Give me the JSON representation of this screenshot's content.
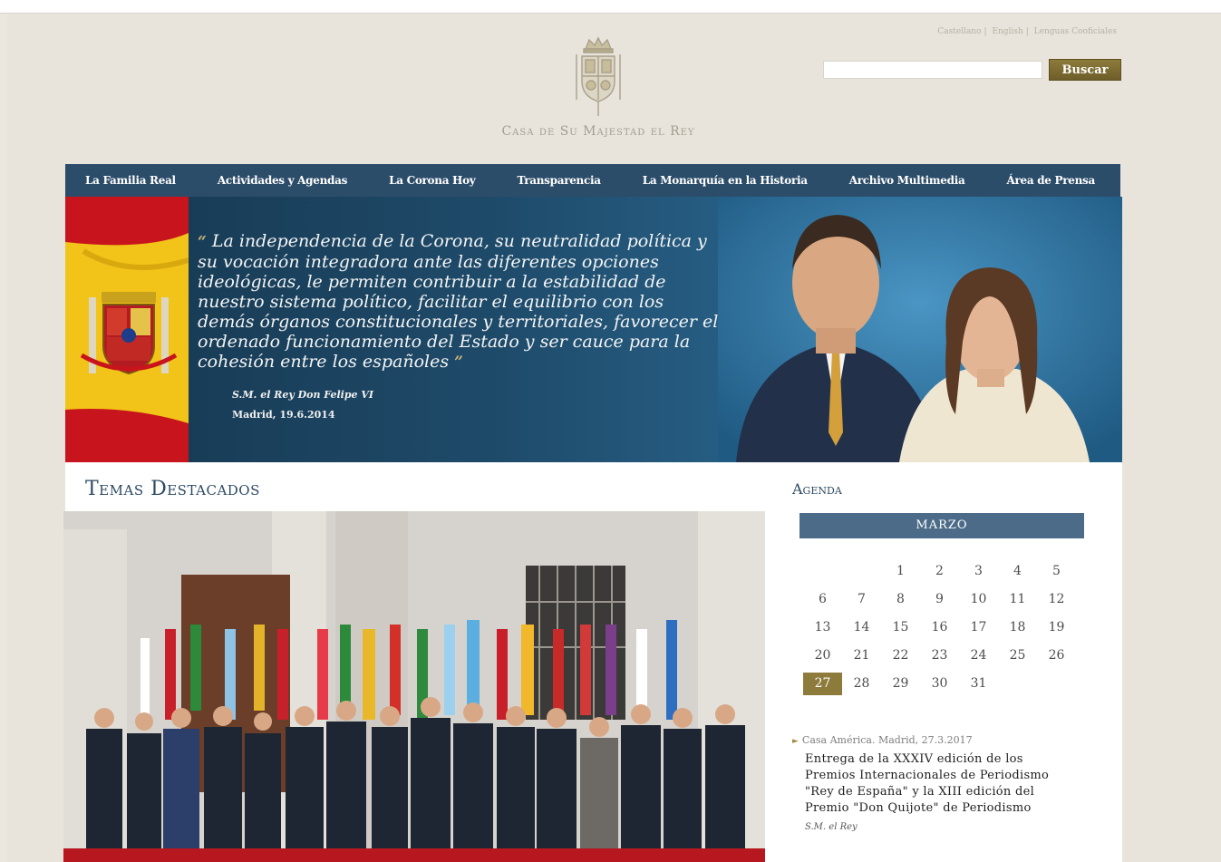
{
  "header": {
    "site_title": "Casa de Su Majestad el Rey",
    "lang_links": [
      "Castellano",
      "English",
      "Lenguas Cooficiales"
    ],
    "search_placeholder": "",
    "search_button": "Buscar"
  },
  "nav": {
    "items": [
      "La Familia Real",
      "Actividades y Agendas",
      "La Corona Hoy",
      "Transparencia",
      "La Monarquía en la Historia",
      "Archivo Multimedia",
      "Área de Prensa"
    ]
  },
  "hero": {
    "quote": "La independencia de la Corona, su neutralidad política y su vocación integradora ante las diferentes opciones ideológicas, le permiten contribuir a la estabilidad de nuestro sistema político, facilitar el equilibrio con los demás órganos constitucionales y territoriales, favorecer el ordenado funcionamiento del Estado y ser cauce para la cohesión entre los españoles",
    "open_mark": "“",
    "close_mark": "”",
    "author": "S.M. el Rey Don Felipe VI",
    "place_date": "Madrid, 19.6.2014"
  },
  "featured": {
    "title": "Temas Destacados"
  },
  "agenda": {
    "title": "Agenda",
    "month": "MARZO",
    "weeks": [
      [
        "",
        "",
        "1",
        "2",
        "3",
        "4",
        "5"
      ],
      [
        "6",
        "7",
        "8",
        "9",
        "10",
        "11",
        "12"
      ],
      [
        "13",
        "14",
        "15",
        "16",
        "17",
        "18",
        "19"
      ],
      [
        "20",
        "21",
        "22",
        "23",
        "24",
        "25",
        "26"
      ],
      [
        "27",
        "28",
        "29",
        "30",
        "31",
        "",
        ""
      ]
    ],
    "selected_day": "27",
    "event": {
      "meta": "Casa América. Madrid, 27.3.2017",
      "title": "Entrega de la XXXIV edición de los Premios Internacionales de Periodismo \"Rey de España\" y la XIII edición del Premio \"Don Quijote\" de Periodismo",
      "who": "S.M. el Rey"
    }
  },
  "colors": {
    "nav_bg": "#2c4d6a",
    "accent_gold": "#8d7b3c",
    "calendar_header": "#4b6b88",
    "title_blue": "#2d4a63"
  }
}
